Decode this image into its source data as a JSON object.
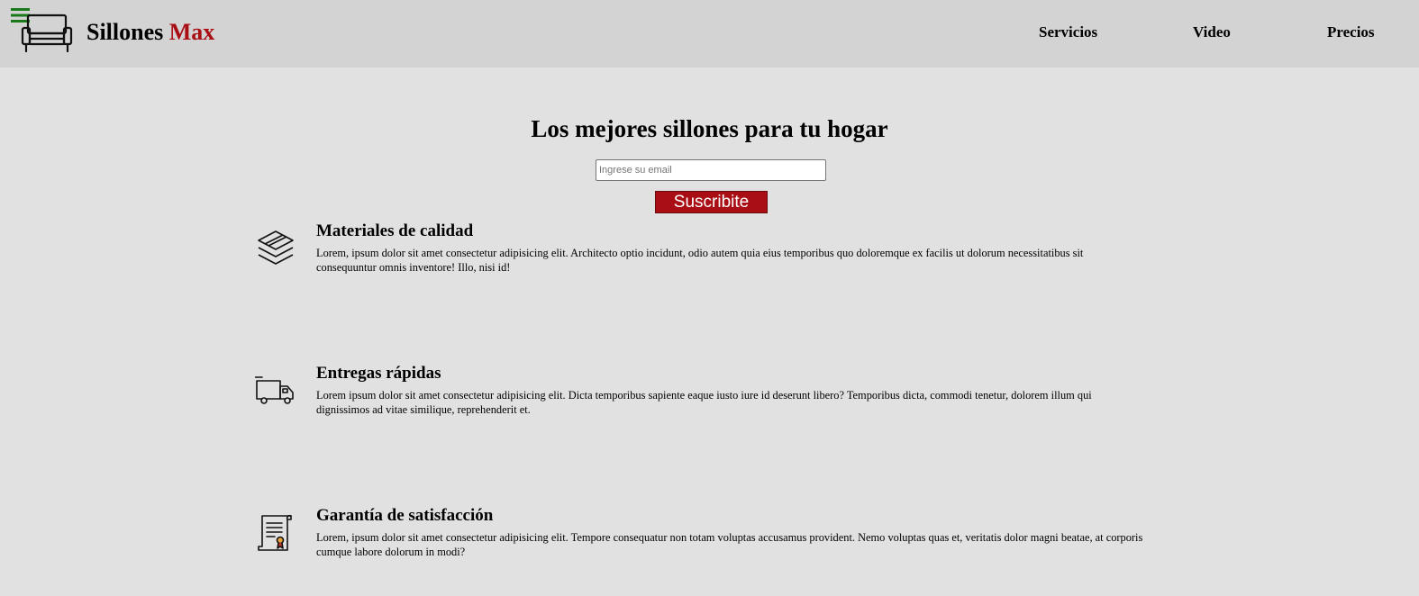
{
  "header": {
    "brand_name": "Sillones",
    "brand_accent": "Max",
    "nav": [
      {
        "label": "Servicios"
      },
      {
        "label": "Video"
      },
      {
        "label": "Precios"
      }
    ],
    "icons": {
      "menu": "hamburger-menu-icon",
      "logo": "sofa-icon"
    }
  },
  "hero": {
    "title": "Los mejores sillones para tu hogar",
    "email_placeholder": "Ingrese su email",
    "subscribe_label": "Suscribite"
  },
  "features": [
    {
      "icon": "layers-icon",
      "title": "Materiales de calidad",
      "text": "Lorem, ipsum dolor sit amet consectetur adipisicing elit. Architecto optio incidunt, odio autem quia eius temporibus quo doloremque ex facilis ut dolorum necessitatibus sit consequuntur omnis inventore! Illo, nisi id!"
    },
    {
      "icon": "delivery-truck-icon",
      "title": "Entregas rápidas",
      "text": "Lorem ipsum dolor sit amet consectetur adipisicing elit. Dicta temporibus sapiente eaque iusto iure id deserunt libero? Temporibus dicta, commodi tenetur, dolorem illum qui dignissimos ad vitae similique, reprehenderit et."
    },
    {
      "icon": "certificate-icon",
      "title": "Garantía de satisfacción",
      "text": "Lorem, ipsum dolor sit amet consectetur adipisicing elit. Tempore consequatur non totam voluptas accusamus provident. Nemo voluptas quas et, veritatis dolor magni beatae, at corporis cumque labore dolorum in modi?"
    }
  ],
  "colors": {
    "page_background": "#e1e1e1",
    "header_background": "#d3d3d3",
    "brand_accent": "#a90e14",
    "menu_icon": "#1a7a1a",
    "button_background": "#a90e14",
    "button_text": "#ffffff"
  }
}
